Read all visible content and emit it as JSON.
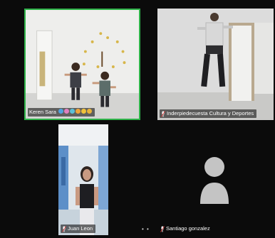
{
  "participants": [
    {
      "id": "t1",
      "name": "Keren Sara",
      "reactions": [
        "#4fa3e0",
        "#e07fc0",
        "#5cc0d8",
        "#f0a53a",
        "#f0c23a",
        "#e8b23a"
      ],
      "speaking": true
    },
    {
      "id": "t2",
      "name": "Inderpiedecuesta Cultura y Deportes",
      "muted": true
    },
    {
      "id": "t3",
      "name": "Juan Leon",
      "muted": true
    },
    {
      "id": "t4",
      "name": "Santiago gonzalez",
      "muted": true,
      "video_off": true
    }
  ],
  "colors": {
    "background": "#0b0b0b",
    "active_speaker_border": "#2fb34a",
    "avatar": "#c4c4c4"
  },
  "more_indicator": "• •"
}
